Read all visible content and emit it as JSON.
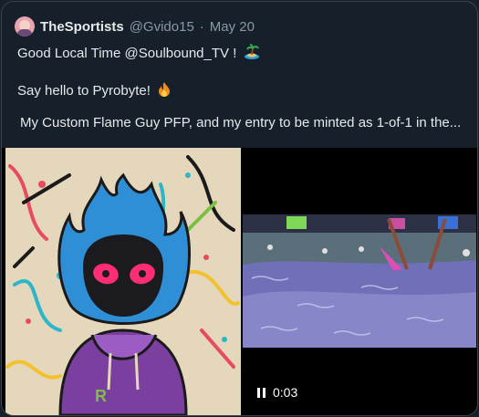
{
  "tweet": {
    "author_name": "TheSportists",
    "handle": "@Gvido15",
    "separator": "·",
    "date": "May 20",
    "line1": "Good Local Time @Soulbound_TV !",
    "line2": "Say hello to Pyrobyte!",
    "line3": "My Custom Flame Guy PFP, and my entry to be minted as 1-of-1 in the..."
  },
  "video": {
    "time": "0:03",
    "state_icon": "pause-icon"
  },
  "colors": {
    "background": "#15202b",
    "border": "#38444d",
    "muted_text": "#8b98a5",
    "primary_text": "#e7e9ea"
  }
}
